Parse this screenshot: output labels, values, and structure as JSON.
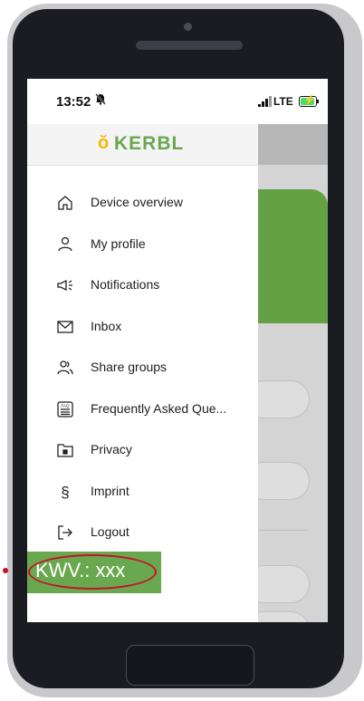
{
  "status_bar": {
    "time": "13:52",
    "network": "LTE"
  },
  "app": {
    "logo_text": "KERBL",
    "logo_mark": "ŏ",
    "brand_color": "#6aa84f",
    "accent_color": "#f5b800"
  },
  "menu": {
    "items": [
      {
        "label": "Device overview",
        "icon": "home-icon"
      },
      {
        "label": "My profile",
        "icon": "user-icon"
      },
      {
        "label": "Notifications",
        "icon": "megaphone-icon"
      },
      {
        "label": "Inbox",
        "icon": "envelope-icon"
      },
      {
        "label": "Share groups",
        "icon": "group-icon"
      },
      {
        "label": "Frequently Asked Que...",
        "icon": "faq-icon"
      },
      {
        "label": "Privacy",
        "icon": "lock-folder-icon"
      },
      {
        "label": "Imprint",
        "icon": "section-sign-icon"
      },
      {
        "label": "Logout",
        "icon": "logout-icon"
      }
    ]
  },
  "version": {
    "label": "KWV.: xxx"
  },
  "annotation_color": "#c8102e"
}
